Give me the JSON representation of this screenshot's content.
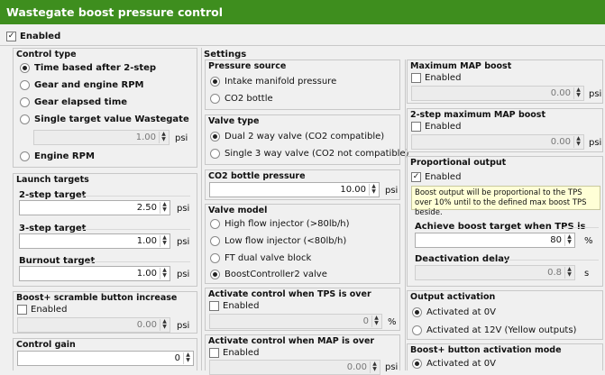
{
  "title": "Wastegate boost pressure control",
  "enabled_label": "Enabled",
  "control_type": {
    "title": "Control type",
    "options": [
      "Time based after 2-step",
      "Gear and engine RPM",
      "Gear elapsed time",
      "Single target value Wastegate",
      "Engine RPM"
    ],
    "selected": 0,
    "single_value": "1.00",
    "unit": "psi"
  },
  "launch": {
    "title": "Launch targets",
    "two_step_label": "2-step target",
    "two_step_value": "2.50",
    "three_step_label": "3-step target",
    "three_step_value": "1.00",
    "burnout_label": "Burnout target",
    "burnout_value": "1.00",
    "unit": "psi"
  },
  "scramble": {
    "title": "Boost+ scramble button increase",
    "enabled_label": "Enabled",
    "value": "0.00",
    "unit": "psi"
  },
  "gain": {
    "title": "Control gain",
    "value": "0"
  },
  "settings": {
    "title": "Settings"
  },
  "pressure_source": {
    "title": "Pressure source",
    "options": [
      "Intake manifold pressure",
      "CO2 bottle"
    ],
    "selected": 0
  },
  "valve_type": {
    "title": "Valve type",
    "options": [
      "Dual 2 way valve (CO2 compatible)",
      "Single 3 way valve (CO2 not compatible)"
    ],
    "selected": 0
  },
  "co2": {
    "title": "CO2 bottle pressure",
    "value": "10.00",
    "unit": "psi"
  },
  "valve_model": {
    "title": "Valve model",
    "options": [
      "High flow injector (>80lb/h)",
      "Low flow injector (<80lb/h)",
      "FT dual valve block",
      "BoostController2 valve"
    ],
    "selected": 3
  },
  "tps_activate": {
    "title": "Activate control when TPS is over",
    "enabled_label": "Enabled",
    "value": "0",
    "unit": "%"
  },
  "map_activate": {
    "title": "Activate control when MAP is over",
    "enabled_label": "Enabled",
    "value": "0.00",
    "unit": "psi"
  },
  "max_map": {
    "title": "Maximum MAP boost",
    "enabled_label": "Enabled",
    "value": "0.00",
    "unit": "psi"
  },
  "two_step_max": {
    "title": "2-step maximum MAP boost",
    "enabled_label": "Enabled",
    "value": "0.00",
    "unit": "psi"
  },
  "proportional": {
    "title": "Proportional output",
    "enabled_label": "Enabled",
    "info": "Boost output will be proportional to the TPS over 10% until to the defined max boost TPS beside.",
    "achieve_label": "Achieve boost target when TPS is",
    "achieve_value": "80",
    "achieve_unit": "%",
    "deact_label": "Deactivation delay",
    "deact_value": "0.8",
    "deact_unit": "s"
  },
  "output_activation": {
    "title": "Output activation",
    "options": [
      "Activated at 0V",
      "Activated at 12V (Yellow outputs)"
    ],
    "selected": 0
  },
  "boost_button": {
    "title": "Boost+ button activation mode",
    "options": [
      "Activated at 0V"
    ],
    "selected": 0
  },
  "colors": {
    "title_bar": "#3e8e1e",
    "info_bg": "#ffffd6"
  }
}
